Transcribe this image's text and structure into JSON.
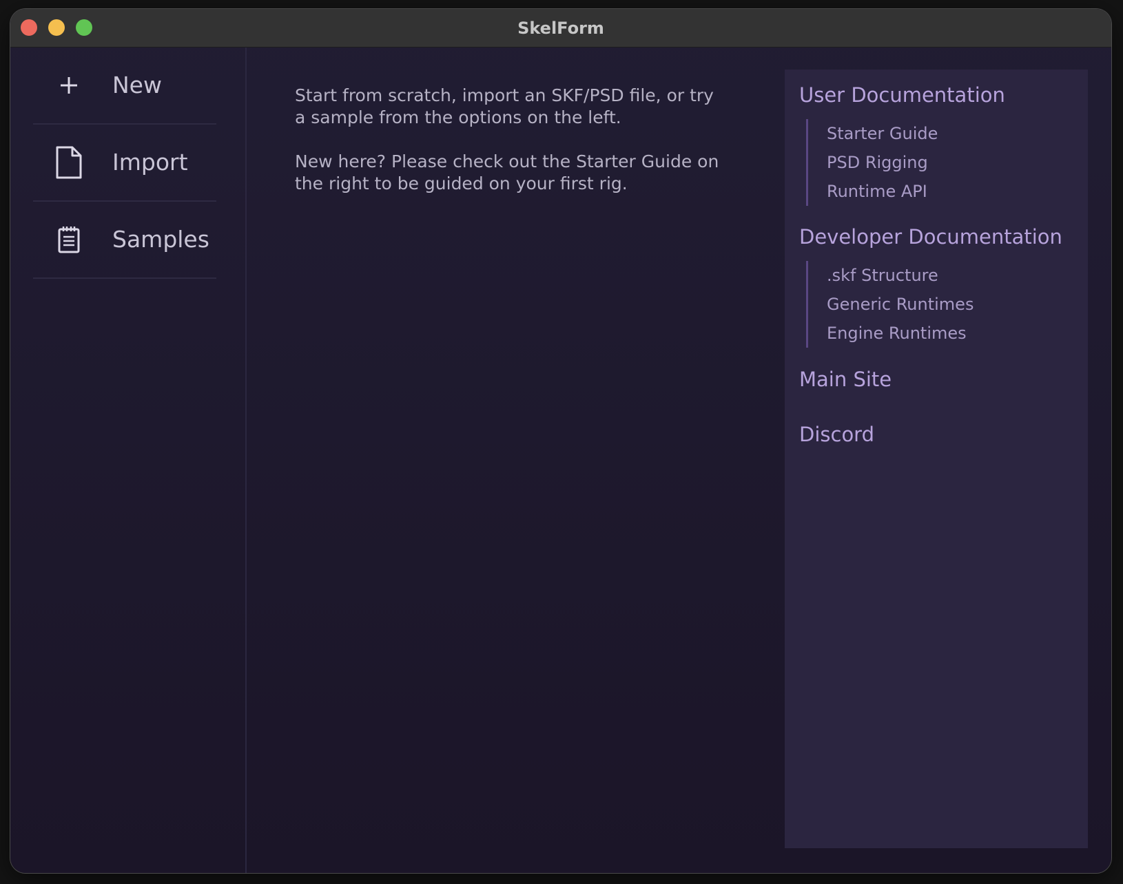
{
  "window": {
    "title": "SkelForm"
  },
  "sidebar": {
    "items": [
      {
        "label": "New",
        "icon": "plus-icon"
      },
      {
        "label": "Import",
        "icon": "file-icon"
      },
      {
        "label": "Samples",
        "icon": "notepad-icon"
      }
    ]
  },
  "main": {
    "paragraphs": [
      "Start from scratch, import an SKF/PSD file, or try a sample from the options on the left.",
      "New here? Please check out the Starter Guide on the right to be guided on your first rig."
    ]
  },
  "docs": {
    "user_heading": "User Documentation",
    "user_links": [
      "Starter Guide",
      "PSD Rigging",
      "Runtime API"
    ],
    "dev_heading": "Developer Documentation",
    "dev_links": [
      ".skf Structure",
      "Generic Runtimes",
      "Engine Runtimes"
    ],
    "main_site": "Main Site",
    "discord": "Discord"
  },
  "colors": {
    "background": "#1e1a2e",
    "panel": "#2b2540",
    "accent": "#b7a3dc",
    "link_bar": "#5a4783"
  }
}
